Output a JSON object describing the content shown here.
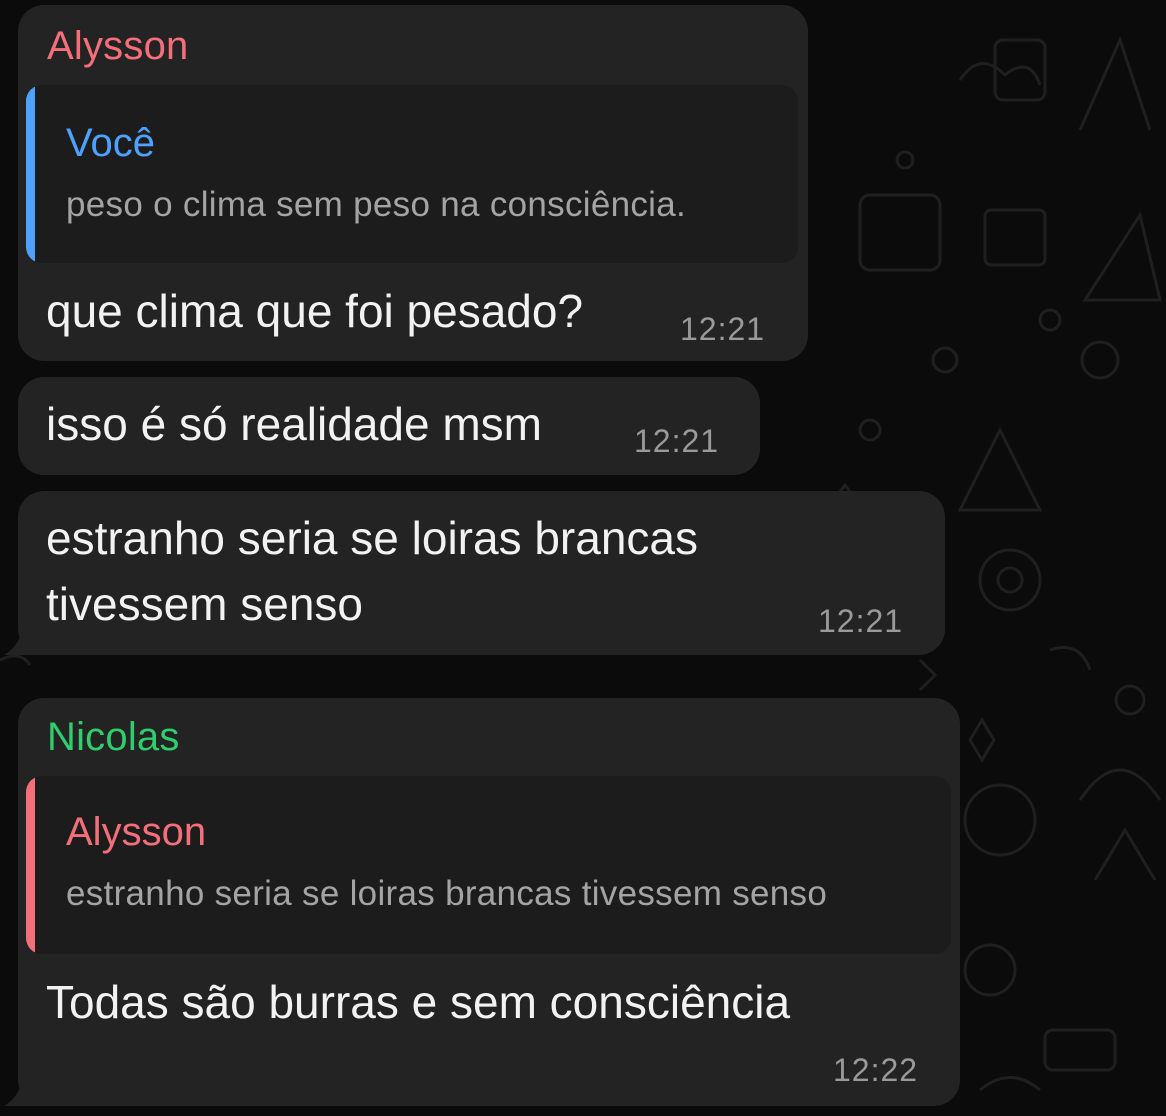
{
  "colors": {
    "background": "#0b0b0b",
    "bubble": "#232323",
    "quote_bg": "#1c1c1c",
    "message_text": "#f2f2f2",
    "timestamp": "#9a9a9a",
    "alysson": "#f56f7b",
    "voce": "#4ea1ff",
    "nicolas": "#2fcd6b"
  },
  "messages": [
    {
      "sender": "Alysson",
      "reply": {
        "author": "Você",
        "text": "peso o clima sem peso na consciência."
      },
      "text": "que clima que foi pesado?",
      "time": "12:21"
    },
    {
      "text": "isso é só realidade msm",
      "time": "12:21"
    },
    {
      "text_lines": [
        "estranho seria se loiras brancas",
        "tivessem senso"
      ],
      "time": "12:21"
    },
    {
      "sender": "Nicolas",
      "reply": {
        "author": "Alysson",
        "text": "estranho seria se loiras brancas tivessem senso"
      },
      "text": "Todas são burras e sem consciência",
      "time": "12:22"
    }
  ]
}
